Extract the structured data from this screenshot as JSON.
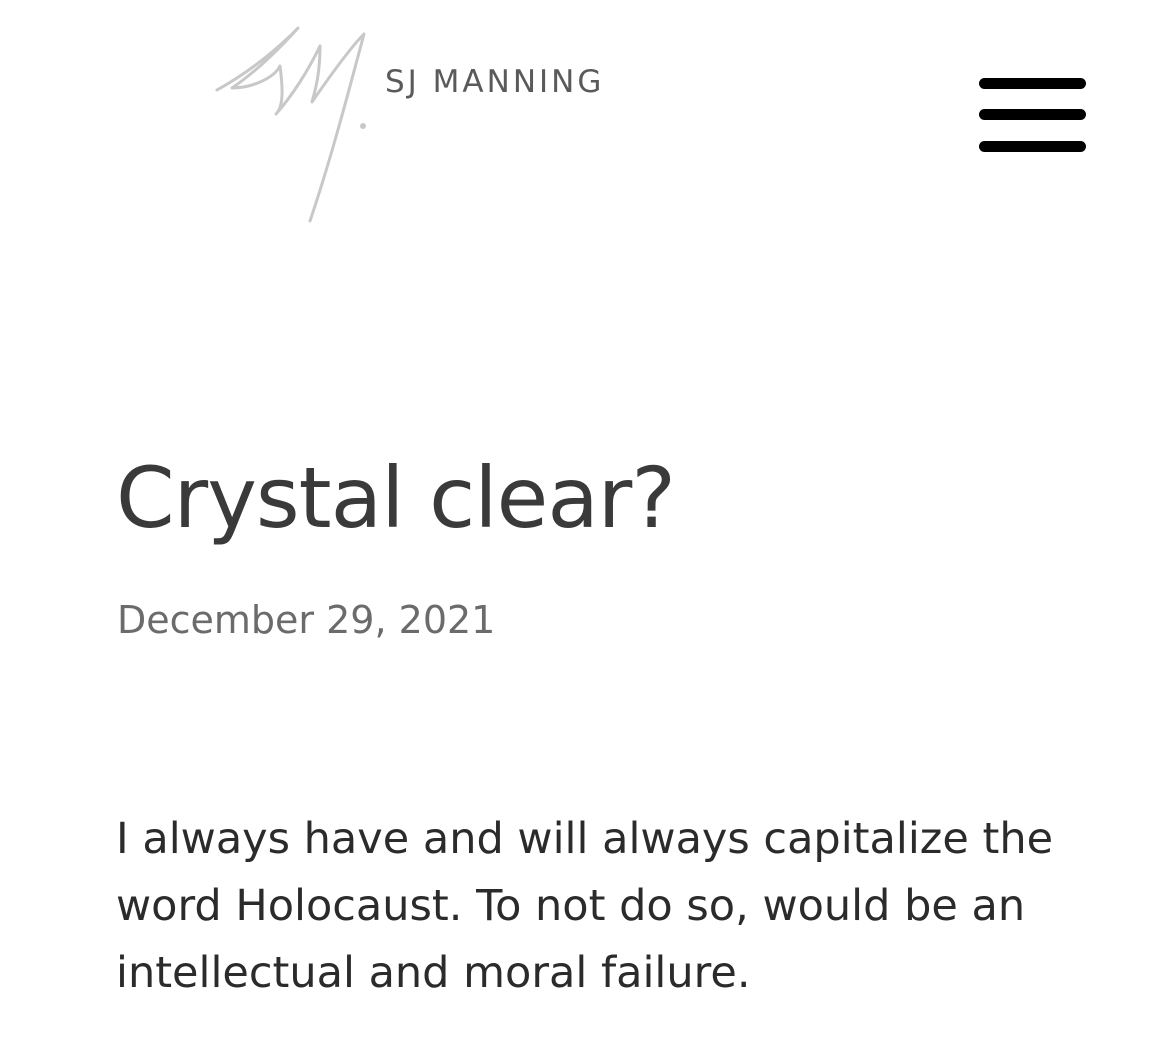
{
  "header": {
    "site_name": "SJ MANNING",
    "logo_signature": "SM",
    "logo_icon": "signature-logo",
    "menu_icon": "hamburger-menu-icon"
  },
  "post": {
    "title": "Crystal clear?",
    "date": "December 29, 2021",
    "body": "I always have and will always capitalize the word Holocaust. To not do so, would be an intellectual and moral failure."
  },
  "colors": {
    "background": "#ffffff",
    "title_text": "#3a3a3a",
    "date_text": "#6b6b6b",
    "body_text": "#2b2b2b",
    "logo_stroke": "#c8c8c8",
    "menu_bars": "#000000"
  }
}
